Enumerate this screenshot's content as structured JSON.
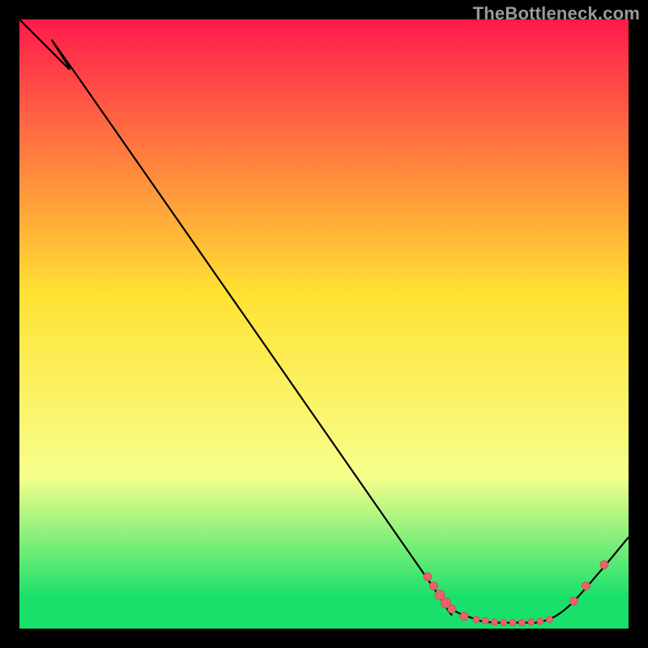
{
  "attribution": "TheBottleneck.com",
  "colors": {
    "top": "#ff1a4b",
    "mid": "#ffe233",
    "low": "#f7ff8c",
    "green": "#18e06a",
    "line": "#000000",
    "dot": "#e9636c",
    "dot_stroke": "#cf4a55"
  },
  "chart_data": {
    "type": "line",
    "title": "",
    "xlabel": "",
    "ylabel": "",
    "xlim": [
      0,
      100
    ],
    "ylim": [
      0,
      100
    ],
    "series": [
      {
        "name": "curve",
        "points": [
          {
            "x": 0,
            "y": 100
          },
          {
            "x": 8,
            "y": 92
          },
          {
            "x": 10,
            "y": 90
          },
          {
            "x": 65,
            "y": 11
          },
          {
            "x": 70,
            "y": 4
          },
          {
            "x": 75,
            "y": 1.5
          },
          {
            "x": 78,
            "y": 1.0
          },
          {
            "x": 82,
            "y": 1.0
          },
          {
            "x": 86,
            "y": 1.2
          },
          {
            "x": 90,
            "y": 3.5
          },
          {
            "x": 95,
            "y": 9
          },
          {
            "x": 100,
            "y": 15
          }
        ]
      },
      {
        "name": "markers",
        "points": [
          {
            "x": 67,
            "y": 8.5,
            "r": 5
          },
          {
            "x": 68,
            "y": 7.0,
            "r": 5
          },
          {
            "x": 69,
            "y": 5.5,
            "r": 6
          },
          {
            "x": 70,
            "y": 4.2,
            "r": 6
          },
          {
            "x": 71,
            "y": 3.2,
            "r": 5
          },
          {
            "x": 73,
            "y": 2.0,
            "r": 5
          },
          {
            "x": 75,
            "y": 1.5,
            "r": 4
          },
          {
            "x": 76.5,
            "y": 1.3,
            "r": 4
          },
          {
            "x": 78,
            "y": 1.1,
            "r": 4
          },
          {
            "x": 79.5,
            "y": 1.0,
            "r": 4
          },
          {
            "x": 81,
            "y": 1.0,
            "r": 4
          },
          {
            "x": 82.5,
            "y": 1.0,
            "r": 4
          },
          {
            "x": 84,
            "y": 1.1,
            "r": 4
          },
          {
            "x": 85.5,
            "y": 1.2,
            "r": 4
          },
          {
            "x": 87,
            "y": 1.5,
            "r": 4
          },
          {
            "x": 91,
            "y": 4.5,
            "r": 5
          },
          {
            "x": 93,
            "y": 7.0,
            "r": 5
          },
          {
            "x": 96,
            "y": 10.5,
            "r": 5
          }
        ]
      }
    ],
    "gradient_stops": [
      {
        "offset": 0,
        "key": "top"
      },
      {
        "offset": 45,
        "key": "mid"
      },
      {
        "offset": 75,
        "key": "low"
      },
      {
        "offset": 95,
        "key": "green"
      },
      {
        "offset": 100,
        "key": "green"
      }
    ]
  }
}
